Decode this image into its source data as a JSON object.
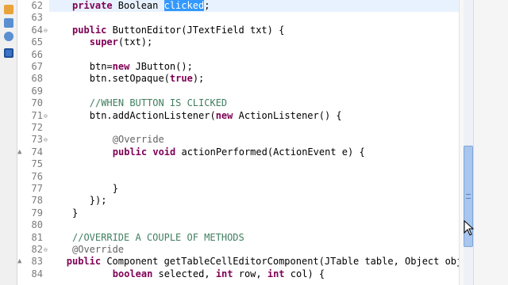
{
  "editor": {
    "lines": [
      {
        "num": "62",
        "marker": "",
        "fold": "",
        "highlight": true,
        "indent": 4,
        "tokens": [
          {
            "t": "kw",
            "v": "private"
          },
          {
            "t": "tx",
            "v": " Boolean "
          },
          {
            "t": "sel",
            "v": "clicked"
          },
          {
            "t": "tx",
            "v": ";"
          }
        ]
      },
      {
        "num": "63",
        "marker": "",
        "fold": "",
        "indent": 0,
        "tokens": []
      },
      {
        "num": "64",
        "marker": "",
        "fold": "⊖",
        "indent": 4,
        "tokens": [
          {
            "t": "kw",
            "v": "public"
          },
          {
            "t": "tx",
            "v": " ButtonEditor(JTextField txt) {"
          }
        ]
      },
      {
        "num": "65",
        "marker": "",
        "fold": "",
        "indent": 7,
        "tokens": [
          {
            "t": "kw",
            "v": "super"
          },
          {
            "t": "tx",
            "v": "(txt);"
          }
        ]
      },
      {
        "num": "66",
        "marker": "",
        "fold": "",
        "indent": 0,
        "tokens": []
      },
      {
        "num": "67",
        "marker": "",
        "fold": "",
        "indent": 7,
        "tokens": [
          {
            "t": "tx",
            "v": "btn="
          },
          {
            "t": "kw",
            "v": "new"
          },
          {
            "t": "tx",
            "v": " JButton();"
          }
        ]
      },
      {
        "num": "68",
        "marker": "",
        "fold": "",
        "indent": 7,
        "tokens": [
          {
            "t": "tx",
            "v": "btn.setOpaque("
          },
          {
            "t": "kw",
            "v": "true"
          },
          {
            "t": "tx",
            "v": ");"
          }
        ]
      },
      {
        "num": "69",
        "marker": "",
        "fold": "",
        "indent": 0,
        "tokens": []
      },
      {
        "num": "70",
        "marker": "",
        "fold": "",
        "indent": 7,
        "tokens": [
          {
            "t": "cm",
            "v": "//WHEN BUTTON IS CLICKED"
          }
        ]
      },
      {
        "num": "71",
        "marker": "",
        "fold": "⊖",
        "indent": 7,
        "tokens": [
          {
            "t": "tx",
            "v": "btn.addActionListener("
          },
          {
            "t": "kw",
            "v": "new"
          },
          {
            "t": "tx",
            "v": " ActionListener() {"
          }
        ]
      },
      {
        "num": "72",
        "marker": "",
        "fold": "",
        "indent": 0,
        "tokens": []
      },
      {
        "num": "73",
        "marker": "",
        "fold": "⊖",
        "indent": 11,
        "tokens": [
          {
            "t": "an",
            "v": "@Override"
          }
        ]
      },
      {
        "num": "74",
        "marker": "▲",
        "fold": "",
        "indent": 11,
        "tokens": [
          {
            "t": "kw",
            "v": "public"
          },
          {
            "t": "tx",
            "v": " "
          },
          {
            "t": "kw",
            "v": "void"
          },
          {
            "t": "tx",
            "v": " actionPerformed(ActionEvent e) {"
          }
        ]
      },
      {
        "num": "75",
        "marker": "",
        "fold": "",
        "indent": 0,
        "tokens": []
      },
      {
        "num": "76",
        "marker": "",
        "fold": "",
        "indent": 0,
        "tokens": []
      },
      {
        "num": "77",
        "marker": "",
        "fold": "",
        "indent": 11,
        "tokens": [
          {
            "t": "tx",
            "v": "}"
          }
        ]
      },
      {
        "num": "78",
        "marker": "",
        "fold": "",
        "indent": 7,
        "tokens": [
          {
            "t": "tx",
            "v": "});"
          }
        ]
      },
      {
        "num": "79",
        "marker": "",
        "fold": "",
        "indent": 4,
        "tokens": [
          {
            "t": "tx",
            "v": "}"
          }
        ]
      },
      {
        "num": "80",
        "marker": "",
        "fold": "",
        "indent": 0,
        "tokens": []
      },
      {
        "num": "81",
        "marker": "",
        "fold": "",
        "indent": 4,
        "tokens": [
          {
            "t": "cm",
            "v": "//OVERRIDE A COUPLE OF METHODS"
          }
        ]
      },
      {
        "num": "82",
        "marker": "",
        "fold": "⊖",
        "indent": 4,
        "tokens": [
          {
            "t": "an",
            "v": "@Override"
          }
        ]
      },
      {
        "num": "83",
        "marker": "▲",
        "fold": "",
        "indent": 3,
        "tokens": [
          {
            "t": "kw",
            "v": "public"
          },
          {
            "t": "tx",
            "v": " Component getTableCellEditorComponent(JTable table, Object obj,"
          }
        ]
      },
      {
        "num": "84",
        "marker": "",
        "fold": "",
        "indent": 11,
        "tokens": [
          {
            "t": "kw",
            "v": "boolean"
          },
          {
            "t": "tx",
            "v": " selected, "
          },
          {
            "t": "kw",
            "v": "int"
          },
          {
            "t": "tx",
            "v": " row, "
          },
          {
            "t": "kw",
            "v": "int"
          },
          {
            "t": "tx",
            "v": " col) {"
          }
        ]
      }
    ]
  },
  "colors": {
    "keyword": "#7f0055",
    "comment": "#3f7f5f",
    "annotation": "#646464",
    "selection": "#3399ff",
    "current_line": "#e8f2fe"
  },
  "icons": [
    "package-explorer-icon",
    "outline-icon",
    "help-icon",
    "console-icon"
  ]
}
